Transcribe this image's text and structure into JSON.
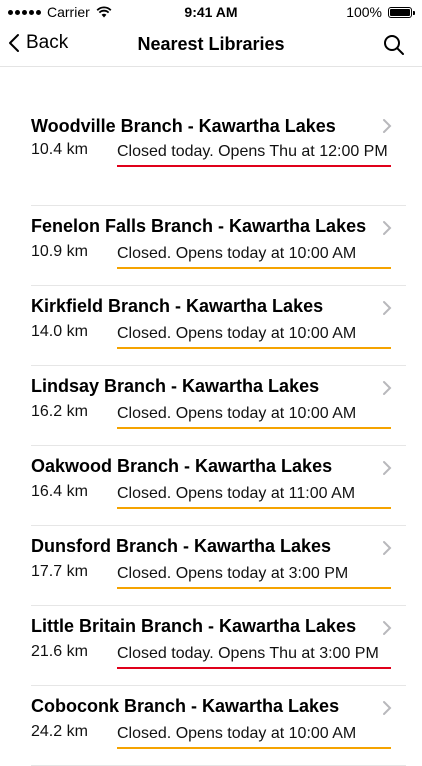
{
  "status_bar": {
    "carrier": "Carrier",
    "time": "9:41 AM",
    "battery": "100%"
  },
  "nav": {
    "back_label": "Back",
    "title": "Nearest Libraries"
  },
  "colors": {
    "open_soon": "#f5a300",
    "closed_today": "#e0001a"
  },
  "libraries": [
    {
      "name": "Woodville Branch - Kawartha Lakes",
      "distance": "10.4 km",
      "hours": "Closed today. Opens Thu at 12:00 PM",
      "status": "closed_today"
    },
    {
      "name": "Fenelon Falls Branch - Kawartha Lakes",
      "distance": "10.9 km",
      "hours": "Closed. Opens today at 10:00 AM",
      "status": "open_soon"
    },
    {
      "name": "Kirkfield Branch - Kawartha Lakes",
      "distance": "14.0 km",
      "hours": "Closed. Opens today at 10:00 AM",
      "status": "open_soon"
    },
    {
      "name": "Lindsay Branch - Kawartha Lakes",
      "distance": "16.2 km",
      "hours": "Closed. Opens today at 10:00 AM",
      "status": "open_soon"
    },
    {
      "name": "Oakwood Branch - Kawartha Lakes",
      "distance": "16.4 km",
      "hours": "Closed. Opens today at 11:00 AM",
      "status": "open_soon"
    },
    {
      "name": "Dunsford Branch - Kawartha Lakes",
      "distance": "17.7 km",
      "hours": "Closed. Opens today at 3:00 PM",
      "status": "open_soon"
    },
    {
      "name": "Little Britain Branch - Kawartha Lakes",
      "distance": "21.6 km",
      "hours": "Closed today. Opens Thu at 3:00 PM",
      "status": "closed_today"
    },
    {
      "name": "Coboconk Branch - Kawartha Lakes",
      "distance": "24.2 km",
      "hours": "Closed. Opens today at 10:00 AM",
      "status": "open_soon"
    }
  ]
}
